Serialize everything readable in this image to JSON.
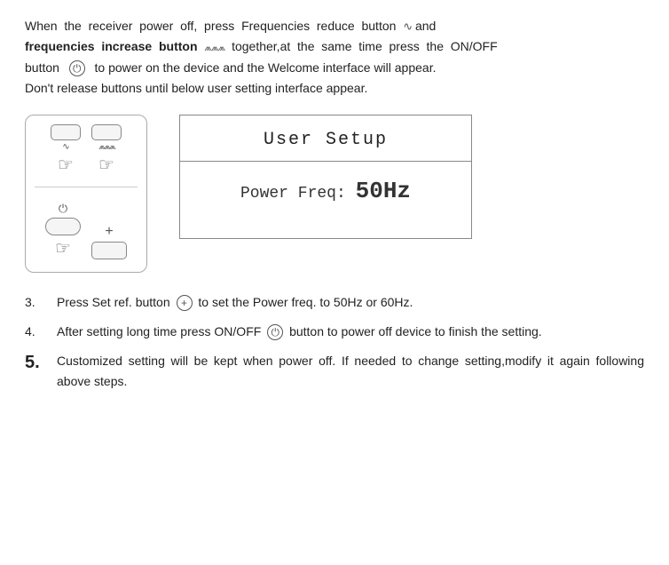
{
  "intro": {
    "line1": "When  the  receiver  power  off,  press  Frequencies  reduce  button",
    "wave1": "∿",
    "conjunction": "and",
    "line2_bold": "frequencies  increase  button",
    "wave2": "⩓",
    "line2_rest": "together,at  the  same  time  press  the  ON/OFF",
    "line3": "button",
    "power_icon": "⏻",
    "line3_rest": "to power on the device and the Welcome interface will appear.",
    "line4": "Don't release buttons until below user setting interface appear."
  },
  "ui_screen": {
    "title": "User Setup",
    "content_label": "Power Freq:",
    "content_value": "50Hz"
  },
  "steps": [
    {
      "num": "3.",
      "text_before": "Press Set ref. button",
      "icon": "+",
      "text_after": "to set the Power freq. to 50Hz or 60Hz."
    },
    {
      "num": "4.",
      "text_before": "After setting long time press ON/OFF",
      "icon": "⏻",
      "text_after": "button to power off device to finish the setting."
    },
    {
      "num": "5.",
      "text": "Customized setting will be kept when power off. If needed to change setting,modify it again following above steps."
    }
  ],
  "colors": {
    "border": "#888",
    "text": "#222",
    "muted": "#555"
  }
}
